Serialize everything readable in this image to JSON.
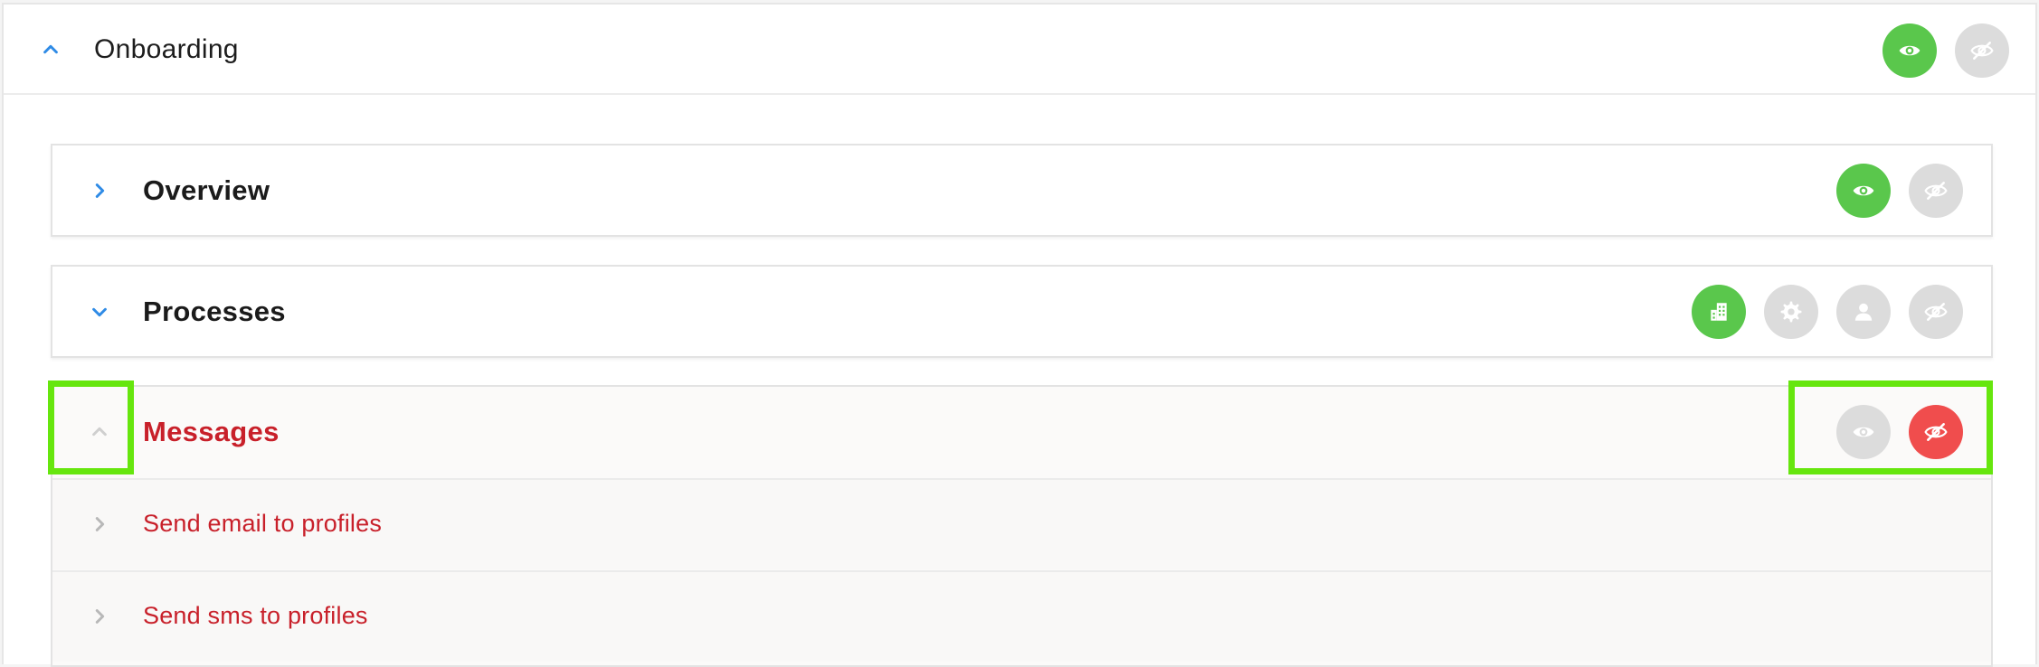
{
  "sections": {
    "onboarding": {
      "title": "Onboarding",
      "expanded": true
    },
    "overview": {
      "title": "Overview",
      "expanded": false
    },
    "processes": {
      "title": "Processes",
      "expanded": true
    },
    "messages": {
      "title": "Messages",
      "expanded": true,
      "items": [
        {
          "label": "Send email to profiles"
        },
        {
          "label": "Send sms to profiles"
        }
      ]
    }
  },
  "icons": {
    "visible": "eye-icon",
    "hidden": "eye-slash-icon",
    "organization": "building-icon",
    "system": "gear-icon",
    "user": "user-icon"
  },
  "colors": {
    "accent_blue": "#2f8be6",
    "visible_green": "#5ac74c",
    "hidden_red": "#f04d4d",
    "inactive_grey": "#dcdcdc",
    "error_text": "#c8202a",
    "highlight": "#66e60e"
  }
}
